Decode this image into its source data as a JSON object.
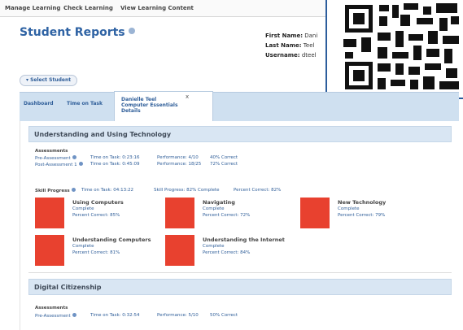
{
  "topnav": {
    "items": [
      "Manage Learning",
      "Check Learning",
      "View Learning Content"
    ]
  },
  "page": {
    "title": "Student Reports"
  },
  "user": {
    "first_name_label": "First Name:",
    "first_name": "Dani",
    "last_name_label": "Last Name:",
    "last_name": "Teel",
    "username_label": "Username:",
    "username": "dteel"
  },
  "select_student_label": "▾ Select Student",
  "tabs": {
    "dashboard": "Dashboard",
    "time_on_task": "Time on Task",
    "active_line1": "Danielle Teel",
    "active_line2": "Computer Essentials",
    "active_line3": "Details",
    "close": "x"
  },
  "sections": [
    {
      "title": "Understanding and Using Technology",
      "assessments_label": "Assessments",
      "assessments": [
        {
          "name": "Pre-Assessment",
          "time": "Time on Task: 0:23:16",
          "performance": "Performance: 4/10",
          "correct": "40% Correct"
        },
        {
          "name": "Post-Assessment 1",
          "time": "Time on Task: 0:45:09",
          "performance": "Performance: 18/25",
          "correct": "72% Correct"
        }
      ],
      "skill_progress": {
        "label": "Skill Progress",
        "time": "Time on Task: 04:13:22",
        "progress": "Skill Progress: 82% Complete",
        "percent": "Percent Correct: 82%"
      },
      "modules": [
        {
          "title": "Using Computers",
          "status": "Complete",
          "pct": "Percent Correct: 85%"
        },
        {
          "title": "Navigating",
          "status": "Complete",
          "pct": "Percent Correct: 72%"
        },
        {
          "title": "New Technology",
          "status": "Complete",
          "pct": "Percent Correct: 79%"
        },
        {
          "title": "Understanding Computers",
          "status": "Complete",
          "pct": "Percent Correct: 81%"
        },
        {
          "title": "Understanding the Internet",
          "status": "Complete",
          "pct": "Percent Correct: 84%"
        }
      ]
    },
    {
      "title": "Digital Citizenship",
      "assessments_label": "Assessments",
      "assessments": [
        {
          "name": "Pre-Assessment",
          "time": "Time on Task: 0:32:54",
          "performance": "Performance: 5/10",
          "correct": "50% Correct"
        }
      ]
    }
  ],
  "colors": {
    "accent": "#2f63a4",
    "tab_bar": "#cfe0f0",
    "module_bar": "#e8412f",
    "section_head": "#d9e6f3"
  },
  "icons": [
    "help-icon",
    "info-icon",
    "close-icon",
    "qr-code-icon"
  ]
}
